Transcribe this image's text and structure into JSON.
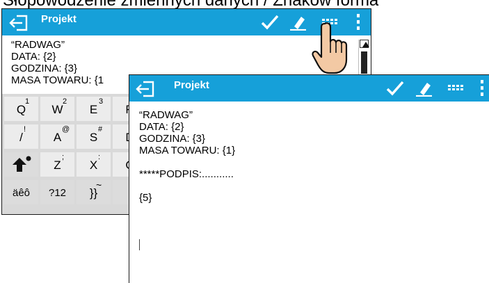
{
  "doc_heading": "Słopowodzenie zmiennych danych / Znakow forma",
  "project_title": "Projekt",
  "back_text_lines": [
    "“RADWAG”",
    "DATA: {2}",
    "GODZINA: {3}",
    "MASA TOWARU: {1"
  ],
  "front_text_lines": [
    "“RADWAG”",
    "DATA: {2}",
    "GODZINA: {3}",
    "MASA TOWARU: {1}",
    "",
    "*****PODPIS:...........",
    "",
    "{5}"
  ],
  "keyboard": {
    "row1": [
      {
        "k": "Q",
        "s": "1"
      },
      {
        "k": "W",
        "s": "2"
      },
      {
        "k": "E",
        "s": "3"
      },
      {
        "k": "R",
        "s": ""
      }
    ],
    "row2": [
      {
        "k": "/",
        "s": "!"
      },
      {
        "k": "A",
        "s": "@"
      },
      {
        "k": "S",
        "s": "#"
      },
      {
        "k": "D",
        "s": ""
      }
    ],
    "row3": [
      {
        "k": "",
        "s": ""
      },
      {
        "k": "Z",
        "s": ";"
      },
      {
        "k": "X",
        "s": ":"
      },
      {
        "k": "C",
        "s": ""
      }
    ],
    "row4": [
      {
        "k": "äêô",
        "s": ""
      },
      {
        "k": "?12",
        "s": ""
      },
      {
        "k": "}}",
        "s": "~"
      },
      {
        "k": "",
        "s": ""
      }
    ]
  },
  "colors": {
    "bar": "#16a0d9",
    "keyboard_bg": "#d9d9d9",
    "key_bg": "#ececec"
  },
  "icons": [
    "exit-icon",
    "check-icon",
    "eraser-icon",
    "keyboard-icon",
    "more-vertical-icon",
    "hand-pointer-icon"
  ]
}
